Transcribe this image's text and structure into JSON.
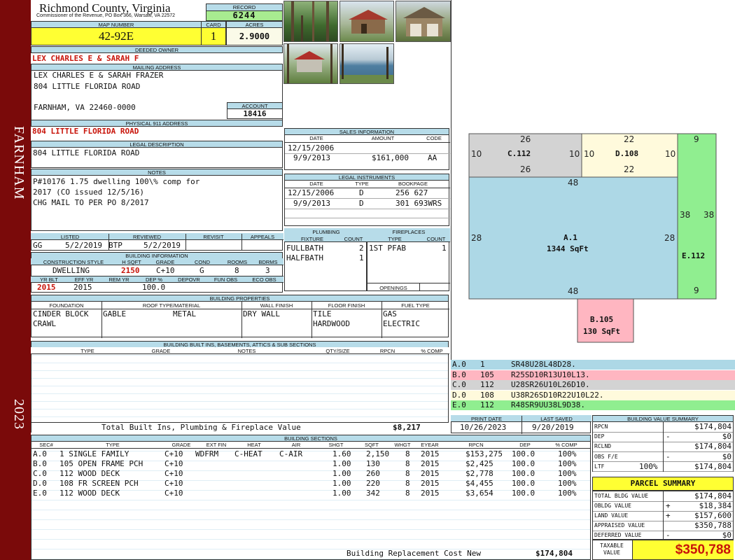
{
  "side": {
    "district": "FARNHAM",
    "year": "2023"
  },
  "header": {
    "county": "Richmond County, Virginia",
    "commissioner": "Commissioner of the Revenue, PO Box 366, Warsaw, VA 22572",
    "record_label": "RECORD",
    "record": "6244",
    "map_label": "MAP NUMBER",
    "map_number": "42-92E",
    "card_label": "CARD",
    "card": "1",
    "acres_label": "ACRES",
    "acres": "2.9000"
  },
  "owner": {
    "label": "DEEDED OWNER",
    "name": "LEX CHARLES E & SARAH F",
    "mail_label": "MAILING ADDRESS",
    "mail_lines": [
      "LEX CHARLES E & SARAH FRAZER",
      "804 LITTLE FLORIDA ROAD",
      "",
      "FARNHAM, VA 22460-0000"
    ],
    "account_label": "ACCOUNT",
    "account": "18416"
  },
  "physical": {
    "label": "PHYSICAL 911 ADDRESS",
    "address": "804 LITTLE FLORIDA ROAD"
  },
  "legal": {
    "label": "LEGAL DESCRIPTION",
    "text": "804 LITTLE FLORIDA ROAD"
  },
  "notes": {
    "label": "NOTES",
    "lines": [
      "P#10176 1.75 dwelling 100\\% comp for",
      "2017 (CO issued 12/5/16)",
      "CHG MAIL TO PER PO 8/2017"
    ]
  },
  "sales": {
    "label": "SALES INFORMATION",
    "cols": [
      "DATE",
      "AMOUNT",
      "CODE"
    ],
    "rows": [
      {
        "date": "12/15/2006",
        "amount": "",
        "code": ""
      },
      {
        "date": "9/9/2013",
        "amount": "$161,000",
        "code": "AA"
      }
    ]
  },
  "legal_instruments": {
    "label": "LEGAL INSTRUMENTS",
    "cols": [
      "DATE",
      "TYPE",
      "BOOKPAGE"
    ],
    "rows": [
      {
        "date": "12/15/2006",
        "type": "D",
        "bookpage": "256 627"
      },
      {
        "date": "9/9/2013",
        "type": "D",
        "bookpage": "301 693WRS"
      }
    ]
  },
  "review": {
    "cols": [
      "LISTED",
      "REVIEWED",
      "REVISIT",
      "APPEALS"
    ],
    "listed_by": "GG",
    "listed_date": "5/2/2019",
    "reviewed_by": "BTP",
    "reviewed_date": "5/2/2019"
  },
  "building_info": {
    "label": "BUILDING INFORMATION",
    "cols": [
      "CONSTRUCTION STYLE",
      "H SQFT",
      "GRADE",
      "COND",
      "ROOMS",
      "BDRMS"
    ],
    "style": "DWELLING",
    "hsqft": "2150",
    "grade": "C+10",
    "cond": "G",
    "rooms": "8",
    "bdrms": "3",
    "cols2": [
      "YR BLT",
      "EFF YR",
      "REM YR",
      "DEP %",
      "DEPOVR",
      "FUN OBS",
      "ECO OBS"
    ],
    "yr_blt": "2015",
    "eff_yr": "2015",
    "dep": "100.0"
  },
  "plumbing": {
    "label": "PLUMBING",
    "cols": [
      "FIXTURE",
      "COUNT"
    ],
    "rows": [
      {
        "f": "FULLBATH",
        "c": "2"
      },
      {
        "f": "HALFBATH",
        "c": "1"
      }
    ]
  },
  "fireplaces": {
    "label": "FIREPLACES",
    "cols": [
      "TYPE",
      "COUNT"
    ],
    "rows": [
      {
        "t": "1ST PFAB",
        "c": "1"
      }
    ],
    "openings_label": "OPENINGS"
  },
  "props": {
    "label": "BUILDING PROPERTIES",
    "cols": [
      "FOUNDATION",
      "ROOF TYPE/MATERIAL",
      "WALL FINISH",
      "FLOOR FINISH",
      "FUEL TYPE"
    ],
    "foundation": [
      "CINDER BLOCK",
      "CRAWL"
    ],
    "roof_type": "GABLE",
    "roof_mat": "METAL",
    "wall": "DRY WALL",
    "floor": [
      "TILE",
      "HARDWOOD"
    ],
    "fuel": [
      "GAS",
      "ELECTRIC"
    ]
  },
  "builtins": {
    "label": "BUILDING BUILT INS, BASEMENTS, ATTICS & SUB SECTIONS",
    "cols": [
      "TYPE",
      "GRADE",
      "NOTES",
      "QTY/SIZE",
      "RPCN",
      "% COMP"
    ],
    "total_label": "Total Built Ins, Plumbing & Fireplace Value",
    "total": "$8,217"
  },
  "dates": {
    "print_label": "PRINT DATE",
    "print": "10/26/2023",
    "saved_label": "LAST SAVED",
    "saved": "9/20/2019"
  },
  "sections": {
    "label": "BUILDING SECTIONS",
    "cols": [
      "SEC#",
      "TYPE",
      "GRADE",
      "EXT FIN",
      "HEAT",
      "AIR",
      "SHGT",
      "SQFT",
      "WHGT",
      "EYEAR",
      "RPCN",
      "DEP",
      "% COMP"
    ],
    "rows": [
      {
        "sec": "A.0",
        "type": "  1 SINGLE FAMILY",
        "grade": "C+10",
        "ext": "WDFRM",
        "heat": "C-HEAT",
        "air": "C-AIR",
        "shgt": "1.60",
        "sqft": "2,150",
        "whgt": "8",
        "eyear": "2015",
        "rpcn": "$153,275",
        "dep": "100.0",
        "comp": "100%"
      },
      {
        "sec": "B.0",
        "type": "105 OPEN FRAME PCH",
        "grade": "C+10",
        "ext": "",
        "heat": "",
        "air": "",
        "shgt": "1.00",
        "sqft": "130",
        "whgt": "8",
        "eyear": "2015",
        "rpcn": "$2,425",
        "dep": "100.0",
        "comp": "100%"
      },
      {
        "sec": "C.0",
        "type": "112 WOOD DECK",
        "grade": "C+10",
        "ext": "",
        "heat": "",
        "air": "",
        "shgt": "1.00",
        "sqft": "260",
        "whgt": "8",
        "eyear": "2015",
        "rpcn": "$2,778",
        "dep": "100.0",
        "comp": "100%"
      },
      {
        "sec": "D.0",
        "type": "108 FR SCREEN PCH",
        "grade": "C+10",
        "ext": "",
        "heat": "",
        "air": "",
        "shgt": "1.00",
        "sqft": "220",
        "whgt": "8",
        "eyear": "2015",
        "rpcn": "$4,455",
        "dep": "100.0",
        "comp": "100%"
      },
      {
        "sec": "E.0",
        "type": "112 WOOD DECK",
        "grade": "C+10",
        "ext": "",
        "heat": "",
        "air": "",
        "shgt": "1.00",
        "sqft": "342",
        "whgt": "8",
        "eyear": "2015",
        "rpcn": "$3,654",
        "dep": "100.0",
        "comp": "100%"
      }
    ],
    "replacement_label": "Building Replacement Cost New",
    "replacement": "$174,804"
  },
  "sketch": {
    "codes": [
      {
        "sec": "A.0",
        "type": "1",
        "code": "SR48U28L48D28.",
        "color": "#add8e6"
      },
      {
        "sec": "B.0",
        "type": "105",
        "code": "R25SD10R13U10L13.",
        "color": "#ffb6c1"
      },
      {
        "sec": "C.0",
        "type": "112",
        "code": "U28SR26U10L26D10.",
        "color": "#d3d3d3"
      },
      {
        "sec": "D.0",
        "type": "108",
        "code": "U38R26SD10R22U10L22.",
        "color": "#fffadc"
      },
      {
        "sec": "E.0",
        "type": "112",
        "code": "R48SR9UU38L9D38.",
        "color": "#90ee90"
      }
    ],
    "shapes": {
      "A": {
        "name": "A.1",
        "area": "1344 SqFt"
      },
      "B": {
        "name": "B.105",
        "area": "130 SqFt"
      },
      "C": {
        "name": "C.112"
      },
      "D": {
        "name": "D.108"
      },
      "E": {
        "name": "E.112"
      }
    },
    "dims": {
      "c_top": "26",
      "c_bottom": "26",
      "c_left": "10",
      "c_right": "10",
      "d_top": "22",
      "d_bottom": "22",
      "d_left": "10",
      "d_right": "10",
      "e_top": "9",
      "e_bottom": "9",
      "e_left": "38",
      "e_right": "38",
      "a_top": "48",
      "a_bottom": "48",
      "a_left": "28",
      "a_right": "28"
    }
  },
  "value_summary": {
    "label": "BUILDING VALUE SUMMARY",
    "rows": [
      {
        "k": "RPCN",
        "sign": "",
        "pct": "",
        "v": "$174,804"
      },
      {
        "k": "DEP",
        "sign": "-",
        "pct": "",
        "v": "$0"
      },
      {
        "k": "RCLND",
        "sign": "",
        "pct": "",
        "v": "$174,804"
      },
      {
        "k": "OBS F/E",
        "sign": "-",
        "pct": "",
        "v": "$0"
      },
      {
        "k": "LTF",
        "sign": "",
        "pct": "100%",
        "v": "$174,804"
      }
    ]
  },
  "parcel": {
    "label": "PARCEL SUMMARY",
    "rows": [
      {
        "k": "TOTAL BLDG VALUE",
        "sign": "",
        "v": "$174,804"
      },
      {
        "k": "OBLDG VALUE",
        "sign": "+",
        "v": "$18,384"
      },
      {
        "k": "LAND VALUE",
        "sign": "+",
        "v": "$157,600"
      },
      {
        "k": "APPRAISED VALUE",
        "sign": "",
        "v": "$350,788"
      },
      {
        "k": "DEFERRED VALUE",
        "sign": "-",
        "v": "$0"
      }
    ],
    "taxable_label1": "TAXABLE",
    "taxable_label2": "VALUE",
    "taxable": "$350,788"
  }
}
